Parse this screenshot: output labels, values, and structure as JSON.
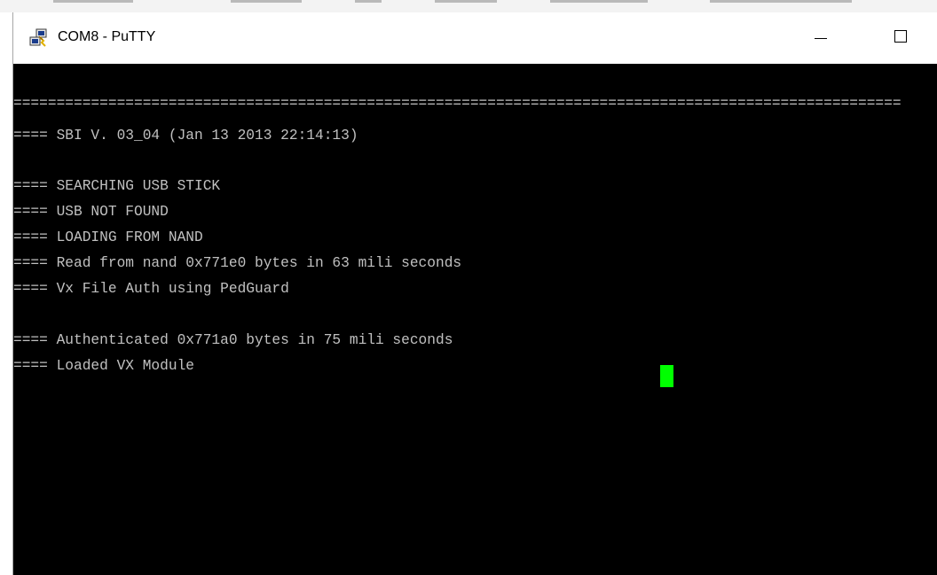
{
  "window": {
    "title": "COM8 - PuTTY",
    "icon": "putty-icon"
  },
  "title_buttons": {
    "minimize_icon": "minimize-icon",
    "maximize_icon": "maximize-icon"
  },
  "terminal": {
    "foreground": "#c0c0c0",
    "background": "#000000",
    "cursor_color": "#00ff00",
    "lines": [
      "=======================================================================================================",
      "==== SBI V. 03_04 (Jan 13 2013 22:14:13)",
      "",
      "==== SEARCHING USB STICK",
      "==== USB NOT FOUND",
      "==== LOADING FROM NAND",
      "==== Read from nand 0x771e0 bytes in 63 mili seconds",
      "==== Vx File Auth using PedGuard",
      "",
      "==== Authenticated 0x771a0 bytes in 75 mili seconds",
      "==== Loaded VX Module"
    ]
  }
}
